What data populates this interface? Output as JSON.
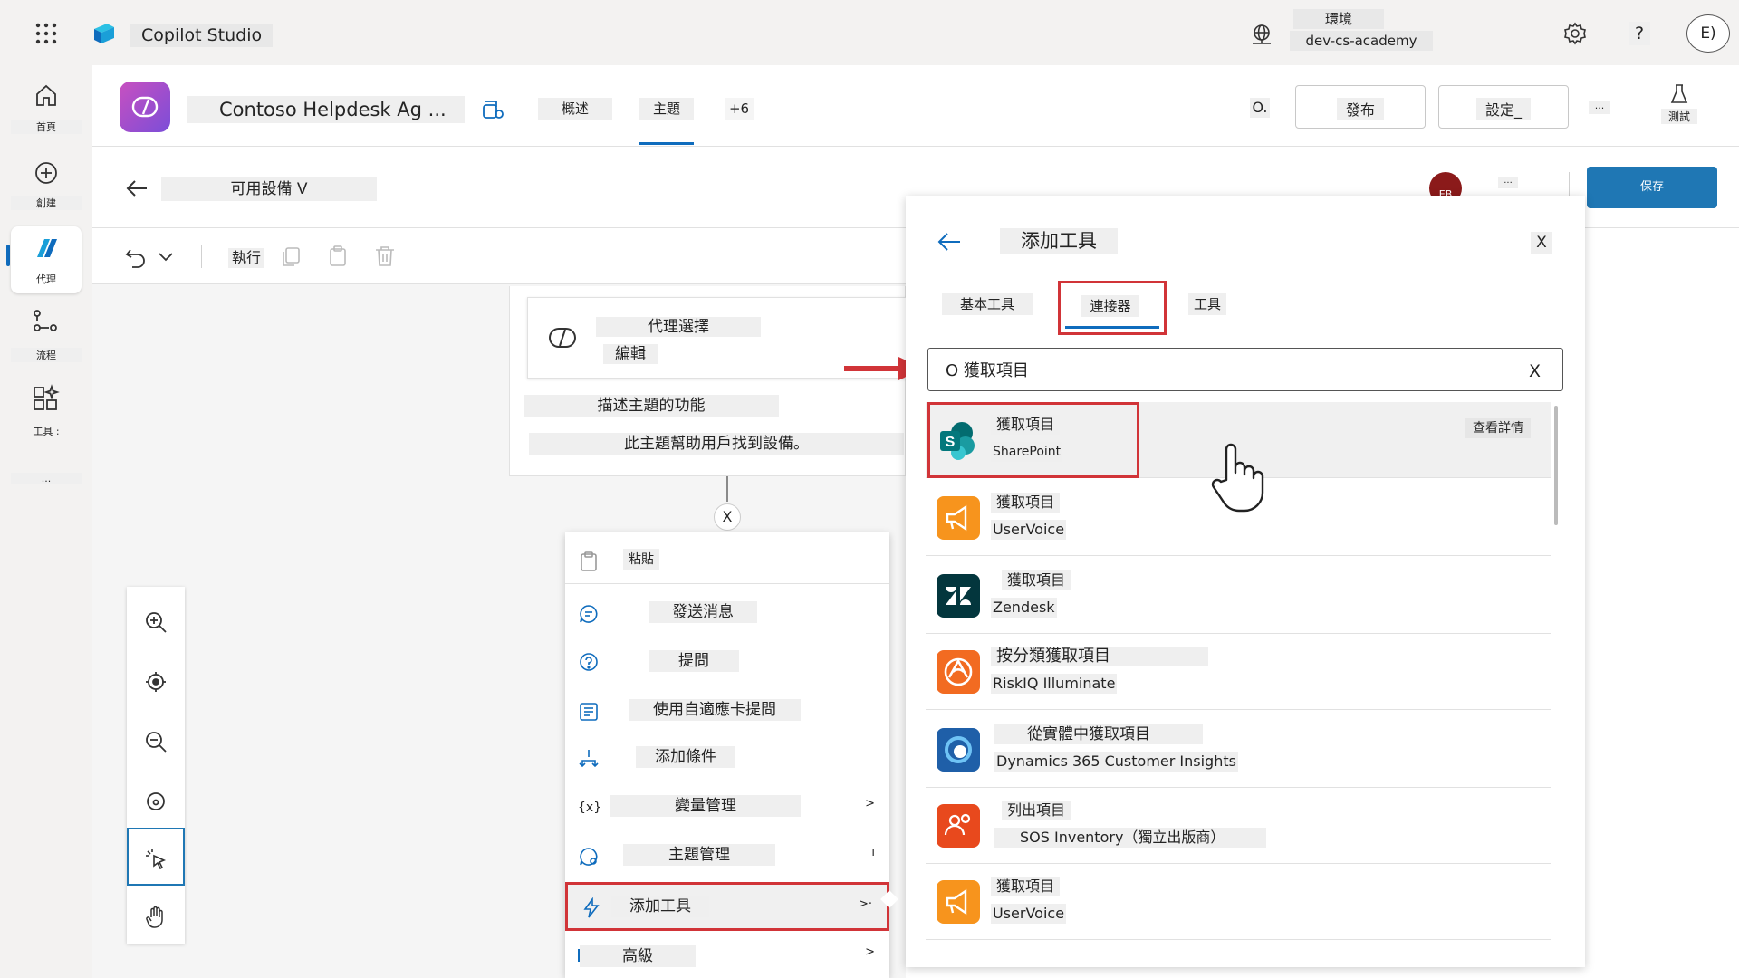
{
  "app": {
    "title": "Copilot Studio",
    "environment_label": "環境",
    "environment_name": "dev-cs-academy",
    "user_initial": "E)"
  },
  "rail": {
    "items": [
      {
        "label": "首頁",
        "icon": "home-icon"
      },
      {
        "label": "創建",
        "icon": "create-icon"
      },
      {
        "label": "代理",
        "icon": "agent-icon"
      },
      {
        "label": "流程",
        "icon": "flow-icon"
      },
      {
        "label": "工具 :",
        "icon": "tools-icon"
      },
      {
        "label": "...",
        "icon": "more-icon"
      }
    ]
  },
  "header": {
    "agent_name": "Contoso Helpdesk Ag ...",
    "tabs": [
      "概述",
      "主題",
      "+6"
    ],
    "zero_label": "O.",
    "publish_label": "發布",
    "settings_label": "設定_",
    "more_label": "...",
    "test_label": "測試"
  },
  "topic": {
    "title": "可用設備 V",
    "user_badge": "EB",
    "more_label": "...",
    "save_label": "保存"
  },
  "toolbar": {
    "run_label": "執行"
  },
  "node": {
    "title": "代理選擇",
    "edit_label": "編輯",
    "description_label": "描述主題的功能",
    "description": "此主題幫助用戶找到設備。",
    "close_label": "X"
  },
  "context_menu": {
    "items": [
      {
        "label": "粘貼",
        "icon": "paste-icon",
        "chevron": ""
      },
      {
        "label": "發送消息",
        "icon": "message-icon",
        "chevron": ""
      },
      {
        "label": "提問",
        "icon": "question-icon",
        "chevron": ""
      },
      {
        "label": "使用自適應卡提問",
        "icon": "adaptive-card-icon",
        "chevron": ""
      },
      {
        "label": "添加條件",
        "icon": "condition-icon",
        "chevron": ""
      },
      {
        "label": "變量管理",
        "icon": "variable-icon",
        "chevron": ">"
      },
      {
        "label": "主題管理",
        "icon": "topic-management-icon",
        "chevron": "ı"
      },
      {
        "label": "添加工具",
        "icon": "tool-icon",
        "chevron": ">·"
      },
      {
        "label": "高級",
        "icon": "advanced-icon",
        "chevron": ">"
      }
    ]
  },
  "panel": {
    "title": "添加工具",
    "close_label": "X",
    "tabs": [
      "基本工具",
      "連接器",
      "工具"
    ],
    "search_value": "O 獲取項目",
    "search_clear": "X",
    "details_label": "查看詳情",
    "results": [
      {
        "name": "獲取項目",
        "connector": "SharePoint",
        "icon": "sharepoint-icon",
        "color": "#038387"
      },
      {
        "name": "獲取項目",
        "connector": "UserVoice",
        "icon": "uservoice-icon",
        "color": "#f7941d"
      },
      {
        "name": "獲取項目",
        "connector": "Zendesk",
        "icon": "zendesk-icon",
        "color": "#03363d"
      },
      {
        "name": "按分類獲取項目",
        "connector": "RiskIQ Illuminate",
        "icon": "riskiq-icon",
        "color": "#f26b21"
      },
      {
        "name": "從實體中獲取項目",
        "connector": "Dynamics 365 Customer Insights",
        "icon": "dynamics-icon",
        "color": "#1f5fa8"
      },
      {
        "name": "列出項目",
        "connector": "SOS Inventory（獨立出版商）",
        "icon": "sos-inventory-icon",
        "color": "#e8491d"
      },
      {
        "name": "獲取項目",
        "connector": "UserVoice",
        "icon": "uservoice-icon",
        "color": "#f7941d"
      }
    ]
  },
  "colors": {
    "accent": "#0f6cbd",
    "highlight_red": "#d13438",
    "save_button": "#1f77b4"
  }
}
